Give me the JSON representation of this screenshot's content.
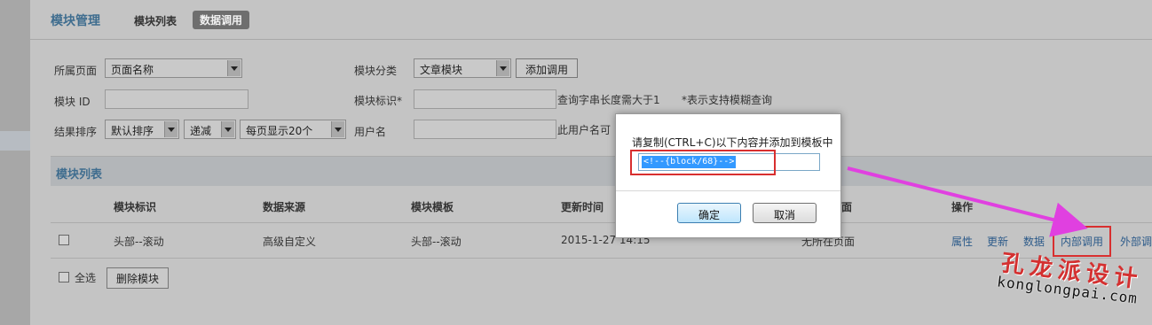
{
  "header": {
    "title": "模块管理",
    "tabs": [
      {
        "label": "模块列表",
        "active": false
      },
      {
        "label": "数据调用",
        "active": true
      }
    ]
  },
  "filters": {
    "page_label": "所属页面",
    "page_value": "页面名称",
    "category_label": "模块分类",
    "category_value": "文章模块",
    "add_button": "添加调用",
    "id_label": "模块 ID",
    "ident_label": "模块标识*",
    "hint1": "查询字串长度需大于1",
    "hint2": "*表示支持模糊查询",
    "sort_label": "结果排序",
    "sort_value": "默认排序",
    "order_value": "递减",
    "perpage_value": "每页显示20个",
    "user_label": "用户名",
    "user_hint": "此用户名可"
  },
  "section": {
    "title": "模块列表"
  },
  "table": {
    "headers": [
      "模块标识",
      "数据来源",
      "模块模板",
      "更新时间",
      "面",
      "操作"
    ],
    "rows": [
      {
        "ident": "头部--滚动",
        "source": "高级自定义",
        "template": "头部--滚动",
        "updated": "2015-1-27 14:15",
        "page": "无所在页面",
        "ops": [
          "属性",
          "更新",
          "数据",
          "内部调用",
          "外部调"
        ]
      }
    ]
  },
  "footer": {
    "select_all": "全选",
    "delete_button": "删除模块"
  },
  "dialog": {
    "prompt": "请复制(CTRL+C)以下内容并添加到模板中",
    "code": "<!--{block/68}-->",
    "ok": "确定",
    "cancel": "取消"
  },
  "watermark": {
    "cn": "孔龙派设计",
    "en": "konglongpai.com"
  },
  "colors": {
    "accent_blue": "#3f6d8f",
    "highlight_red": "#d82f2f",
    "arrow_magenta": "#e040e0",
    "selection_blue": "#3399ff"
  }
}
